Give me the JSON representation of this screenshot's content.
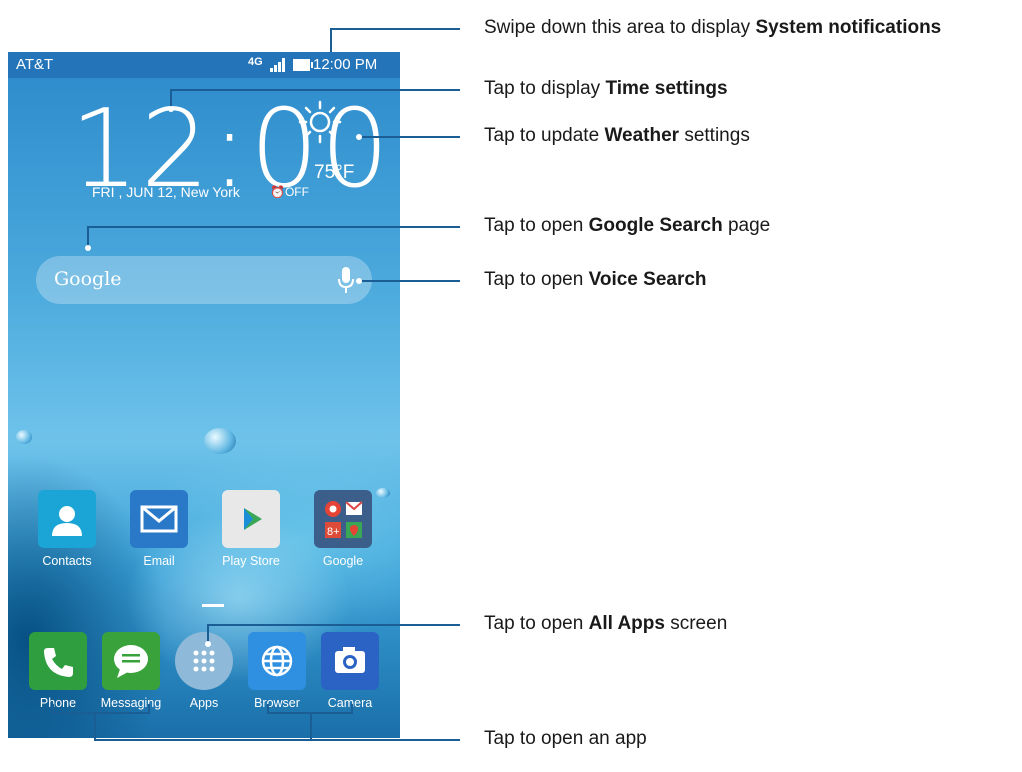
{
  "status_bar": {
    "carrier": "AT&T",
    "network": "4G",
    "time": "12:00 PM"
  },
  "clock": {
    "time": "12:00",
    "date": "FRI , JUN 12, New York",
    "alarm": "⏰OFF",
    "temperature": "75°F"
  },
  "search": {
    "brand": "Google"
  },
  "favorite_apps": [
    {
      "label": "Contacts",
      "icon": "contacts-icon",
      "color": "#1aa5d6"
    },
    {
      "label": "Email",
      "icon": "email-icon",
      "color": "#2a78c8"
    },
    {
      "label": "Play Store",
      "icon": "play-store-icon",
      "color": "#e8e8e8"
    },
    {
      "label": "Google",
      "icon": "google-folder-icon",
      "color": "#3b5f8a"
    }
  ],
  "dock_apps": [
    {
      "label": "Phone",
      "icon": "phone-icon",
      "color": "#2e9e3e"
    },
    {
      "label": "Messaging",
      "icon": "messaging-icon",
      "color": "#3aa23a"
    },
    {
      "label": "Apps",
      "icon": "apps-icon",
      "color": "#8fb9d8"
    },
    {
      "label": "Browser",
      "icon": "browser-icon",
      "color": "#2f8fe0"
    },
    {
      "label": "Camera",
      "icon": "camera-icon",
      "color": "#2b63c4"
    }
  ],
  "annotations": {
    "notifications": {
      "pre": "Swipe down this area to display ",
      "bold": "System notifications",
      "post": ""
    },
    "time": {
      "pre": "Tap to display ",
      "bold": "Time settings",
      "post": ""
    },
    "weather": {
      "pre": "Tap to update ",
      "bold": "Weather",
      "post": " settings"
    },
    "google_search": {
      "pre": "Tap to open ",
      "bold": "Google Search",
      "post": " page"
    },
    "voice_search": {
      "pre": "Tap to open ",
      "bold": "Voice Search",
      "post": ""
    },
    "all_apps": {
      "pre": "Tap to open ",
      "bold": "All Apps",
      "post": " screen"
    },
    "open_app": {
      "pre": "Tap to open an app",
      "bold": "",
      "post": ""
    }
  }
}
